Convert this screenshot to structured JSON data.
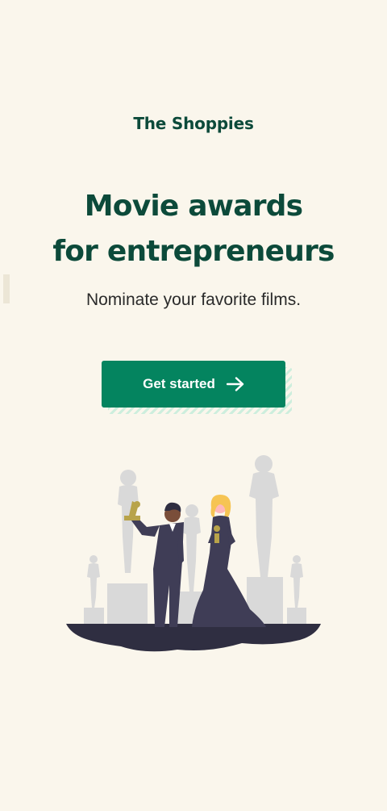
{
  "header": {
    "brand": "The Shoppies"
  },
  "hero": {
    "title_line1": "Movie awards",
    "title_line2": "for entrepreneurs",
    "subtitle": "Nominate your favorite films."
  },
  "cta": {
    "label": "Get started",
    "icon": "arrow-right-icon"
  },
  "colors": {
    "background": "#faf6ec",
    "brand_dark_green": "#0c4a3a",
    "button_green": "#04845f",
    "figure_dark": "#3f3d56",
    "statue_grey": "#d9d9d9",
    "trophy_gold": "#b8a34a"
  }
}
